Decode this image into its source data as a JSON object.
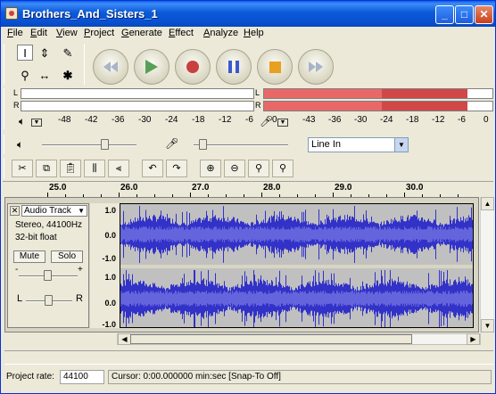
{
  "window": {
    "title": "Brothers_And_Sisters_1"
  },
  "title_buttons": {
    "minimize": "_",
    "maximize": "□",
    "close": "✕"
  },
  "menu": [
    "File",
    "Edit",
    "View",
    "Project",
    "Generate",
    "Effect",
    "Analyze",
    "Help"
  ],
  "tools": {
    "select": "I",
    "envelope": "⇕",
    "draw": "✎",
    "zoom": "⚲",
    "timeshift": "↔",
    "multi": "✱"
  },
  "meters": {
    "left_label": "L",
    "right_label": "R",
    "play_scale": [
      "-48",
      "-42",
      "-36",
      "-30",
      "-24",
      "-18",
      "-12",
      "-6",
      "0"
    ],
    "rec_scale": [
      "-43",
      "-36",
      "-30",
      "-24",
      "-18",
      "-12",
      "-6",
      "0"
    ],
    "rec_left_level": 0.89,
    "rec_right_level": 0.89
  },
  "mixer": {
    "input_source": "Line In"
  },
  "ruler": {
    "labels": [
      "25.0",
      "26.0",
      "27.0",
      "28.0",
      "29.0",
      "30.0"
    ]
  },
  "track": {
    "name": "Audio Track",
    "format_line1": "Stereo, 44100Hz",
    "format_line2": "32-bit float",
    "mute": "Mute",
    "solo": "Solo",
    "gain_minus": "-",
    "gain_plus": "+",
    "pan_left": "L",
    "pan_right": "R",
    "vruler_top": [
      "1.0",
      "0.0",
      "-1.0"
    ],
    "vruler_bottom": [
      "1.0",
      "0.0",
      "-1.0"
    ]
  },
  "status": {
    "project_rate_label": "Project rate:",
    "project_rate_value": "44100",
    "cursor": "Cursor: 0:00.000000 min:sec   [Snap-To Off]"
  },
  "colors": {
    "wave": "#3232c8",
    "meter_fill": "#e85858",
    "titlebar": "#0a5fe8"
  }
}
